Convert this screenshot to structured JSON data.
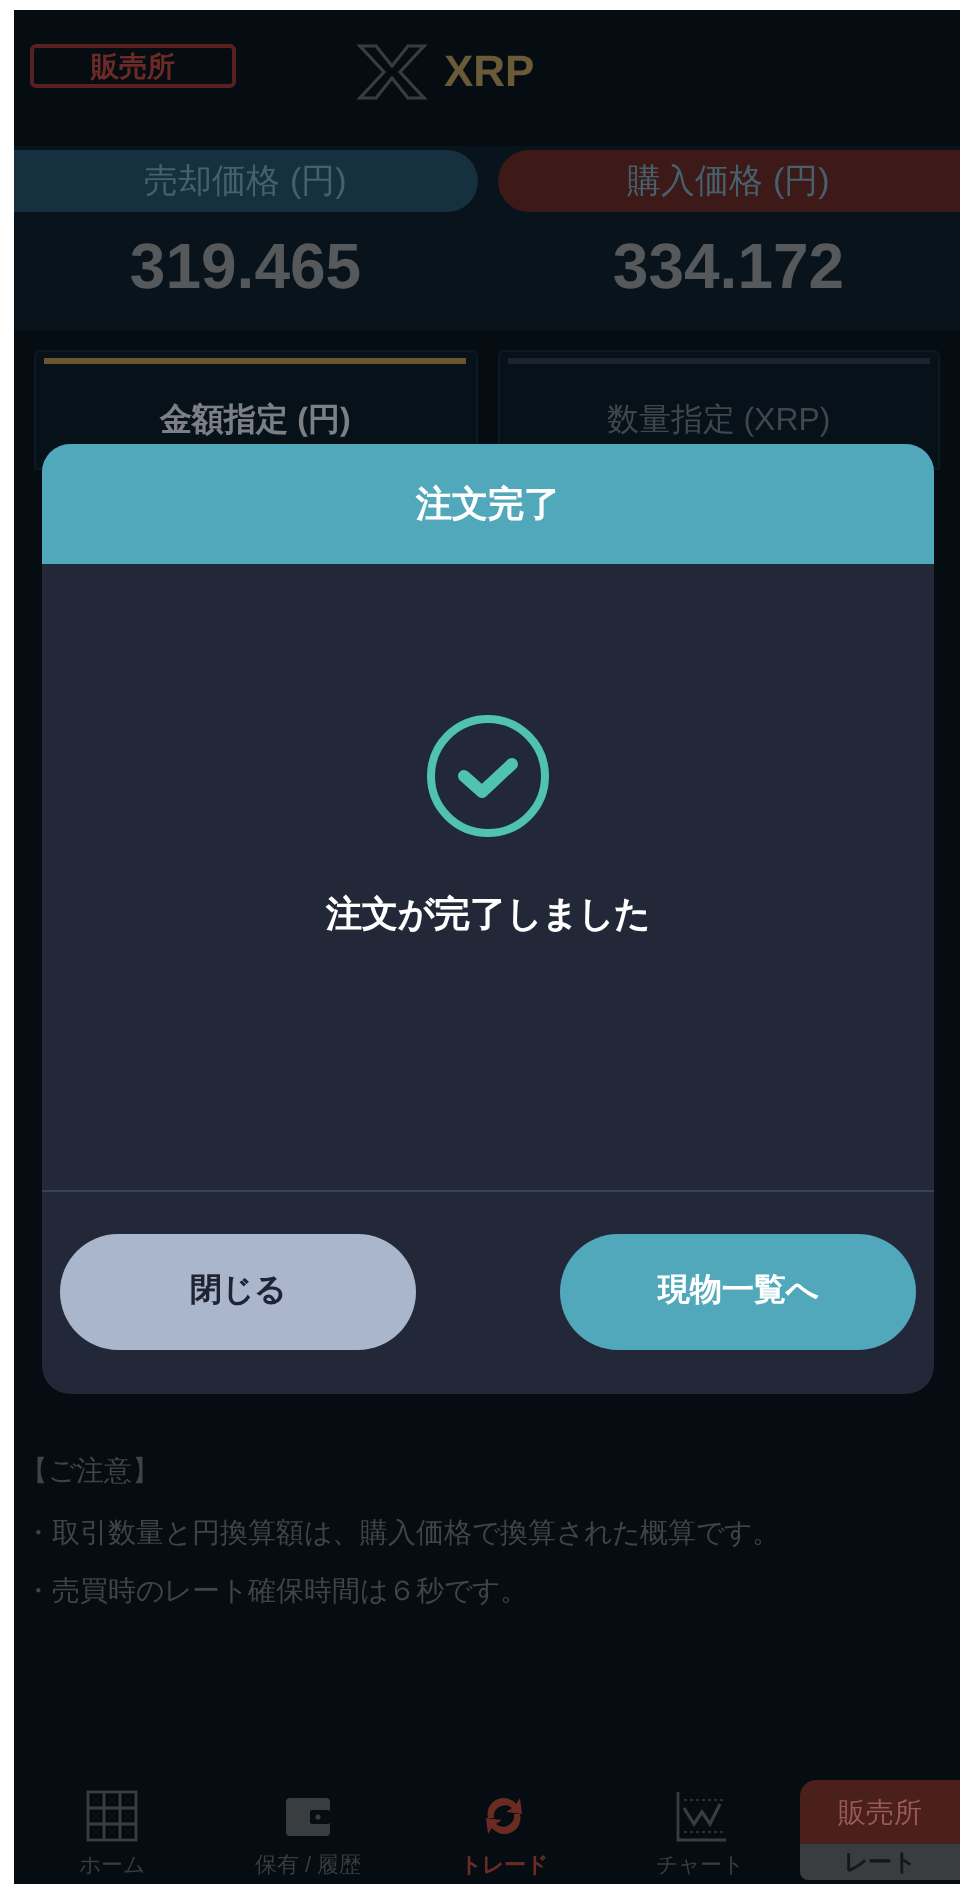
{
  "header": {
    "market_badge": "販売所",
    "title": "XRP"
  },
  "prices": [
    {
      "kind": "sell",
      "label": "売却価格 (円)",
      "value": "319.465"
    },
    {
      "kind": "buy",
      "label": "購入価格 (円)",
      "value": "334.172"
    }
  ],
  "order_tabs": [
    {
      "label": "金額指定 (円)",
      "selected": true
    },
    {
      "label": "数量指定 (XRP)",
      "selected": false
    }
  ],
  "dialog": {
    "title": "注文完了",
    "message": "注文が完了しました",
    "buttons": [
      {
        "kind": "secondary",
        "label": "閉じる"
      },
      {
        "kind": "primary",
        "label": "現物一覧へ"
      }
    ]
  },
  "notes": {
    "heading": "【ご注意】",
    "items": [
      "・取引数量と円換算額は、購入価格で換算された概算です。",
      "・売買時のレート確保時間は６秒です。"
    ]
  },
  "tab_bar": {
    "items": [
      {
        "kind": "home",
        "label": "ホーム",
        "selected": false
      },
      {
        "kind": "holdings",
        "label": "保有 / 履歴",
        "selected": false
      },
      {
        "kind": "trade",
        "label": "トレード",
        "selected": true
      },
      {
        "kind": "chart",
        "label": "チャート",
        "selected": false
      }
    ],
    "rate_button": {
      "top": "販売所",
      "bottom": "レート"
    }
  }
}
